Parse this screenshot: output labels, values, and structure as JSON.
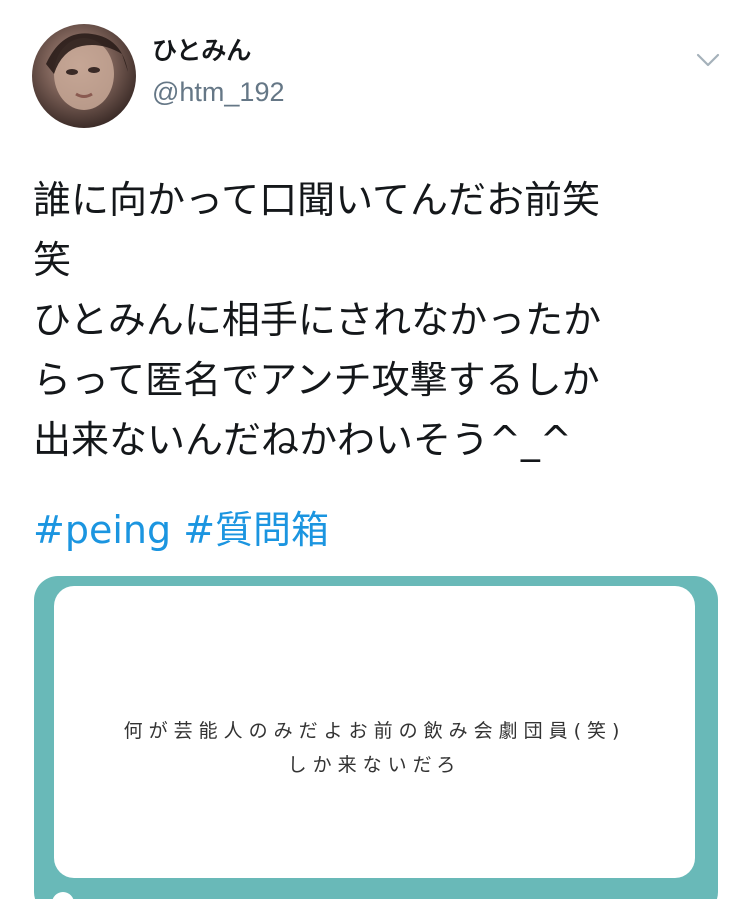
{
  "user": {
    "display_name": "ひとみん",
    "handle": "@htm_192"
  },
  "tweet": {
    "lines": [
      "誰に向かって口聞いてんだお前笑",
      "笑",
      "ひとみんに相手にされなかったか",
      "らって匿名でアンチ攻撃するしか",
      "出来ないんだねかわいそう^_^"
    ],
    "hashtags": [
      "#peing",
      "#質問箱"
    ]
  },
  "card": {
    "question_lines": [
      "何が芸能人のみだよお前の飲み会劇団員(笑)",
      "しか来ないだろ"
    ]
  },
  "colors": {
    "hashtag": "#1b95e0",
    "card_border": "#69b9b8",
    "text": "#14171a",
    "handle": "#657786"
  },
  "icons": {
    "avatar": "profile-photo",
    "menu": "chevron-down-icon"
  }
}
